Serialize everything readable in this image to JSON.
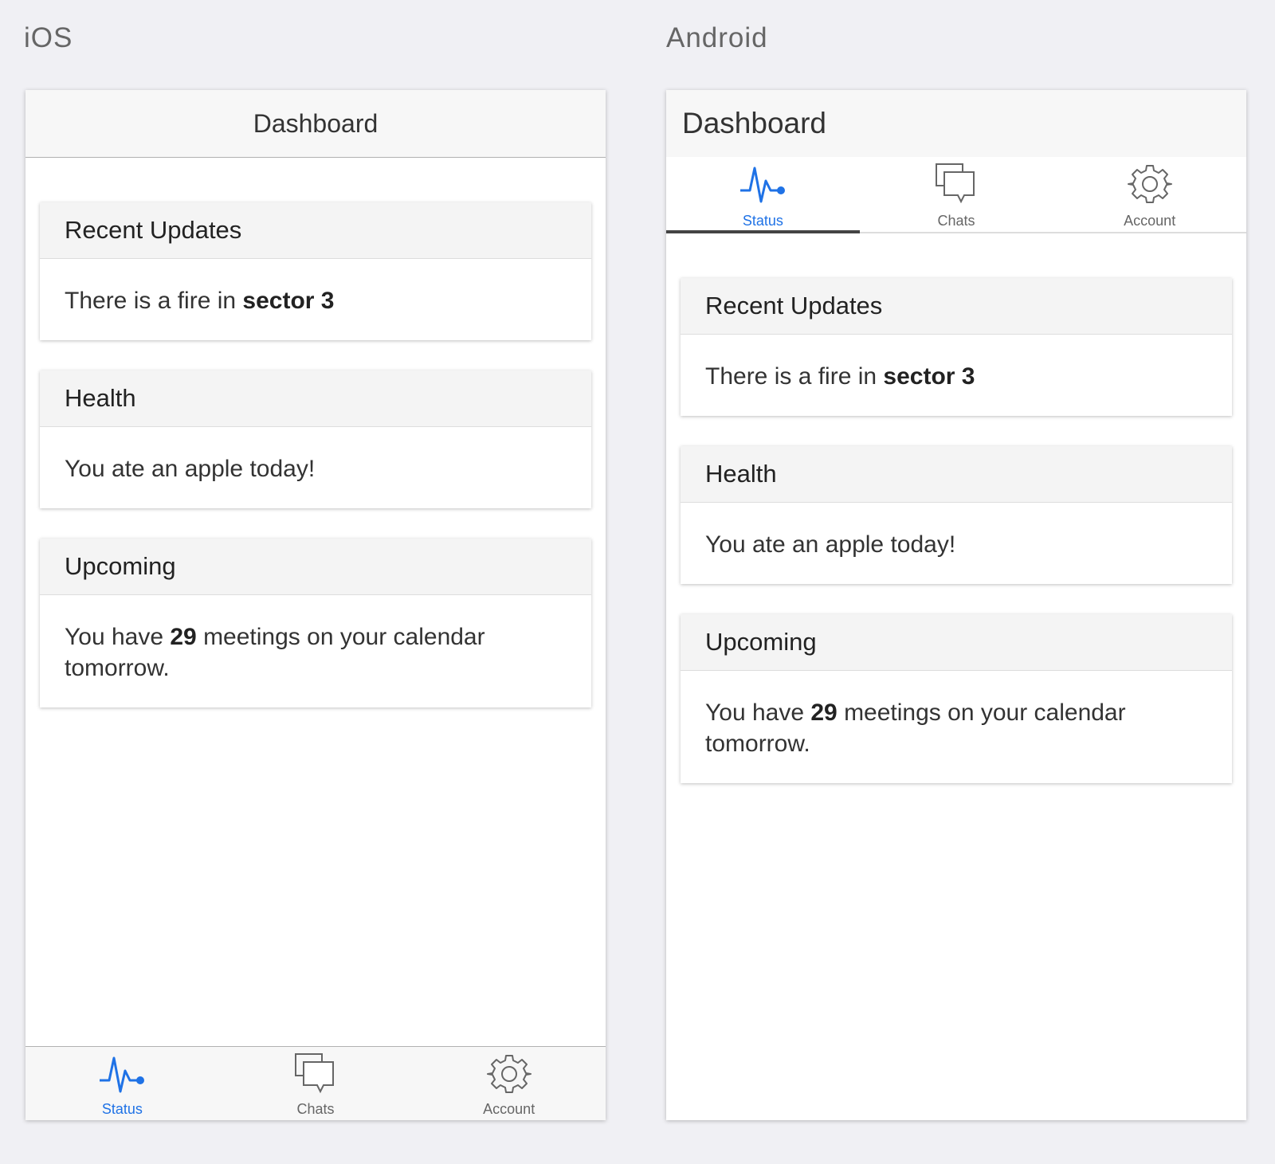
{
  "labels": {
    "ios": "iOS",
    "android": "Android"
  },
  "header": {
    "title": "Dashboard"
  },
  "tabs": [
    {
      "label": "Status",
      "icon": "pulse-icon",
      "active": true
    },
    {
      "label": "Chats",
      "icon": "chat-bubbles-icon",
      "active": false
    },
    {
      "label": "Account",
      "icon": "gear-icon",
      "active": false
    }
  ],
  "cards": [
    {
      "title": "Recent Updates",
      "text_before": "There is a fire in ",
      "text_bold": "sector 3",
      "text_after": ""
    },
    {
      "title": "Health",
      "text_before": "You ate an apple today!",
      "text_bold": "",
      "text_after": ""
    },
    {
      "title": "Upcoming",
      "text_before": "You have ",
      "text_bold": "29",
      "text_after": " meetings on your calendar tomorrow."
    }
  ],
  "colors": {
    "accent": "#1f72e6",
    "icon_inactive": "#666666",
    "background": "#f0f0f4"
  }
}
